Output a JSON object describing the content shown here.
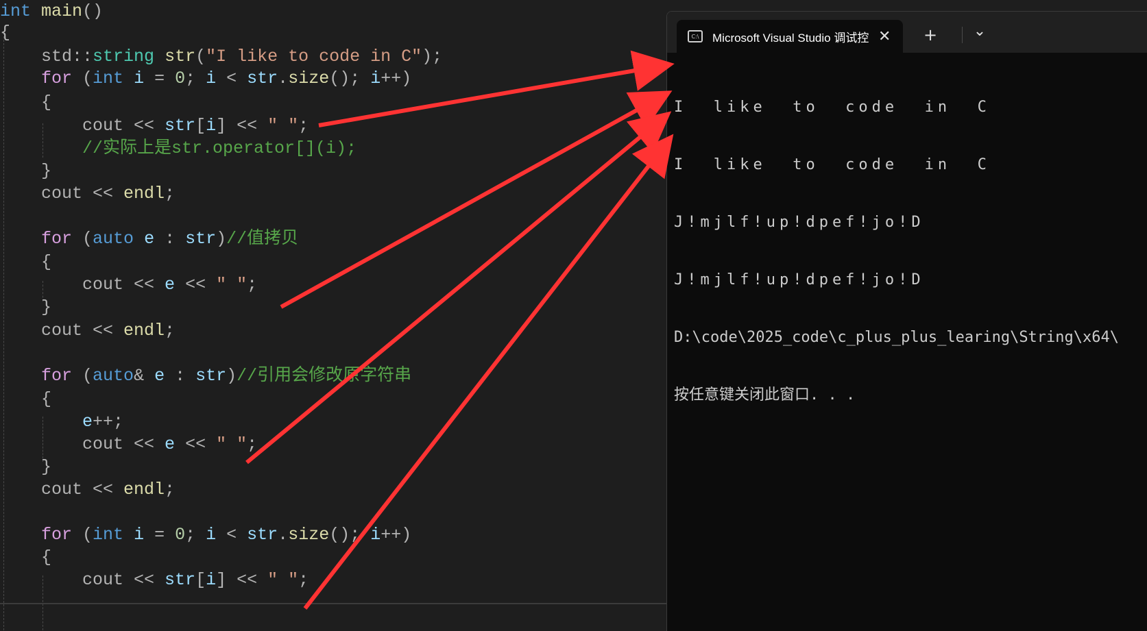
{
  "editor": {
    "lines": [
      [
        [
          "t",
          "int"
        ],
        [
          "f",
          " main"
        ],
        [
          "p",
          "()"
        ]
      ],
      [
        [
          "p",
          "{"
        ]
      ],
      [
        [
          "p",
          "    std::"
        ],
        [
          "ns",
          "string"
        ],
        [
          "p",
          " "
        ],
        [
          "f",
          "str"
        ],
        [
          "p",
          "("
        ],
        [
          "s",
          "\"I like to code in C\""
        ],
        [
          "p",
          ");"
        ]
      ],
      [
        [
          "k",
          "    for"
        ],
        [
          "p",
          " ("
        ],
        [
          "t",
          "int"
        ],
        [
          "v",
          " i"
        ],
        [
          "p",
          " = "
        ],
        [
          "n",
          "0"
        ],
        [
          "p",
          "; "
        ],
        [
          "v",
          "i"
        ],
        [
          "p",
          " < "
        ],
        [
          "v",
          "str"
        ],
        [
          "p",
          "."
        ],
        [
          "f",
          "size"
        ],
        [
          "p",
          "(); "
        ],
        [
          "v",
          "i"
        ],
        [
          "p",
          "++)"
        ]
      ],
      [
        [
          "p",
          "    {"
        ]
      ],
      [
        [
          "p",
          "        cout << "
        ],
        [
          "v",
          "str"
        ],
        [
          "p",
          "["
        ],
        [
          "v",
          "i"
        ],
        [
          "p",
          "] << "
        ],
        [
          "s",
          "\" \""
        ],
        [
          "p",
          ";"
        ]
      ],
      [
        [
          "c",
          "        //实际上是str.operator[](i);"
        ]
      ],
      [
        [
          "p",
          "    }"
        ]
      ],
      [
        [
          "p",
          "    cout << "
        ],
        [
          "f",
          "endl"
        ],
        [
          "p",
          ";"
        ]
      ],
      [],
      [
        [
          "k",
          "    for"
        ],
        [
          "p",
          " ("
        ],
        [
          "t",
          "auto"
        ],
        [
          "v",
          " e"
        ],
        [
          "p",
          " : "
        ],
        [
          "v",
          "str"
        ],
        [
          "p",
          ")"
        ],
        [
          "c",
          "//值拷贝"
        ]
      ],
      [
        [
          "p",
          "    {"
        ]
      ],
      [
        [
          "p",
          "        cout << "
        ],
        [
          "v",
          "e"
        ],
        [
          "p",
          " << "
        ],
        [
          "s",
          "\" \""
        ],
        [
          "p",
          ";"
        ]
      ],
      [
        [
          "p",
          "    }"
        ]
      ],
      [
        [
          "p",
          "    cout << "
        ],
        [
          "f",
          "endl"
        ],
        [
          "p",
          ";"
        ]
      ],
      [],
      [
        [
          "k",
          "    for"
        ],
        [
          "p",
          " ("
        ],
        [
          "t",
          "auto"
        ],
        [
          "p",
          "&"
        ],
        [
          "v",
          " e"
        ],
        [
          "p",
          " : "
        ],
        [
          "v",
          "str"
        ],
        [
          "p",
          ")"
        ],
        [
          "c",
          "//引用会修改原字符串"
        ]
      ],
      [
        [
          "p",
          "    {"
        ]
      ],
      [
        [
          "v",
          "        e"
        ],
        [
          "p",
          "++;"
        ]
      ],
      [
        [
          "p",
          "        cout << "
        ],
        [
          "v",
          "e"
        ],
        [
          "p",
          " << "
        ],
        [
          "s",
          "\" \""
        ],
        [
          "p",
          ";"
        ]
      ],
      [
        [
          "p",
          "    }"
        ]
      ],
      [
        [
          "p",
          "    cout << "
        ],
        [
          "f",
          "endl"
        ],
        [
          "p",
          ";"
        ]
      ],
      [],
      [
        [
          "k",
          "    for"
        ],
        [
          "p",
          " ("
        ],
        [
          "t",
          "int"
        ],
        [
          "v",
          " i"
        ],
        [
          "p",
          " = "
        ],
        [
          "n",
          "0"
        ],
        [
          "p",
          "; "
        ],
        [
          "v",
          "i"
        ],
        [
          "p",
          " < "
        ],
        [
          "v",
          "str"
        ],
        [
          "p",
          "."
        ],
        [
          "f",
          "size"
        ],
        [
          "p",
          "(); "
        ],
        [
          "v",
          "i"
        ],
        [
          "p",
          "++)"
        ]
      ],
      [
        [
          "p",
          "    {"
        ]
      ],
      [
        [
          "p",
          "        cout << "
        ],
        [
          "v",
          "str"
        ],
        [
          "p",
          "["
        ],
        [
          "v",
          "i"
        ],
        [
          "p",
          "] << "
        ],
        [
          "s",
          "\" \""
        ],
        [
          "p",
          ";"
        ]
      ]
    ]
  },
  "terminal": {
    "tab_icon": "C:\\",
    "tab_title": "Microsoft Visual Studio 调试控",
    "close_glyph": "✕",
    "new_tab_glyph": "+",
    "dropdown_glyph": "⌄",
    "output": [
      "I  like  to  code  in  C",
      "I  like  to  code  in  C",
      "J!mjlf!up!dpef!jo!D",
      "J!mjlf!up!dpef!jo!D",
      "D:\\code\\2025_code\\c_plus_plus_learing\\String\\x64\\",
      "按任意键关闭此窗口. . ."
    ]
  },
  "colors": {
    "arrow": "#ff3333",
    "editor_bg": "#1e1e1e",
    "terminal_bg": "#0c0c0c"
  }
}
